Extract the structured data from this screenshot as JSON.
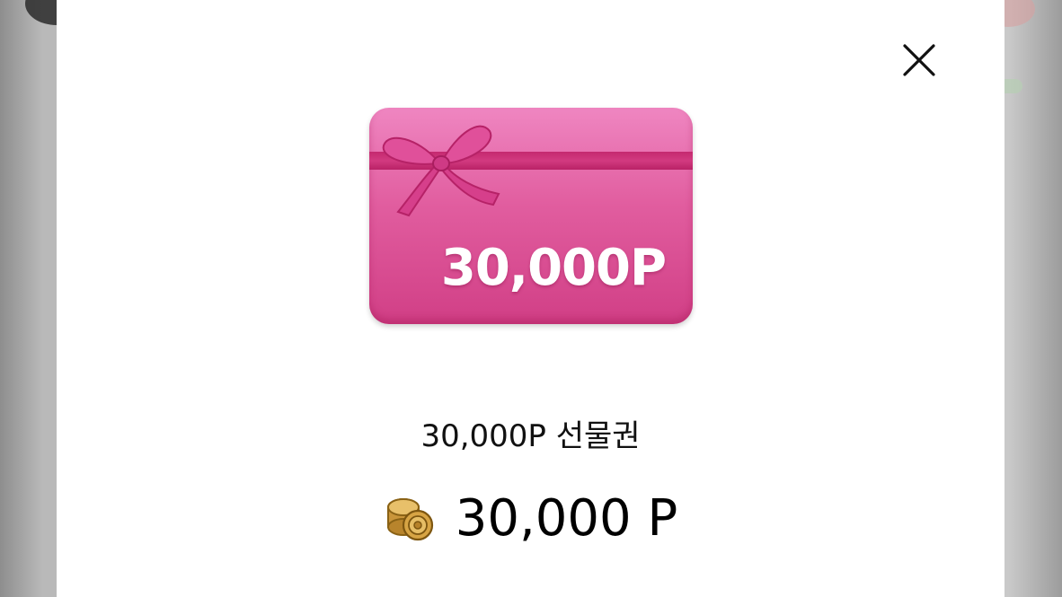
{
  "modal": {
    "close_icon": "close-icon",
    "gift_card": {
      "amount_label": "30,000P",
      "colors": {
        "card": "#e15d9f",
        "ribbon": "#c4296f",
        "text": "#ffffff"
      },
      "icon": "ribbon-bow-icon"
    },
    "product_name": "30,000P 선물권",
    "price": {
      "icon": "coin-stack-icon",
      "value": "30,000 P"
    }
  }
}
